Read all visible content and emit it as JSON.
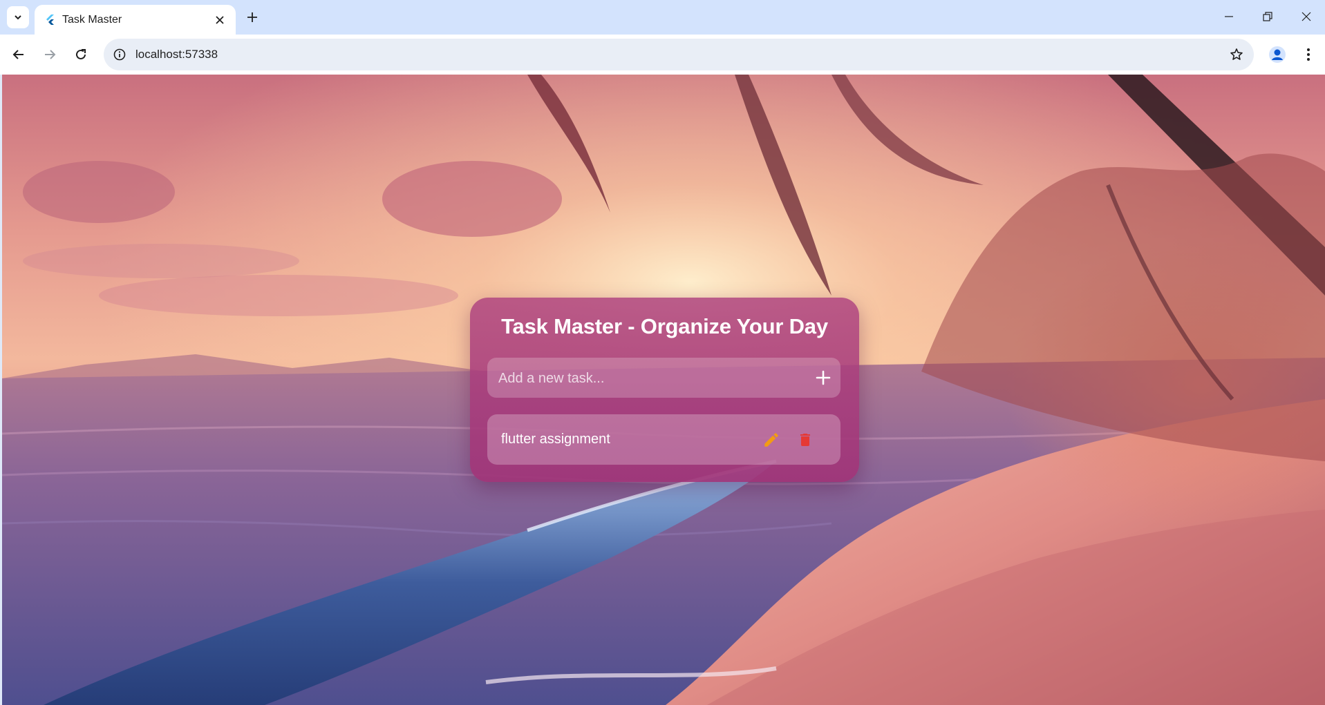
{
  "browser": {
    "tab_title": "Task Master",
    "url": "localhost:57338"
  },
  "app": {
    "title": "Task Master - Organize Your Day",
    "input_placeholder": "Add a new task...",
    "input_value": "",
    "tasks": [
      {
        "label": "flutter assignment"
      }
    ]
  },
  "colors": {
    "card": "#a8407e",
    "edit_icon": "#f39c12",
    "delete_icon": "#e53935",
    "tabbar": "#d3e3fd"
  },
  "icons": {
    "tab_favicon": "flutter-icon",
    "add": "plus-icon",
    "edit": "pencil-icon",
    "delete": "trash-icon"
  }
}
